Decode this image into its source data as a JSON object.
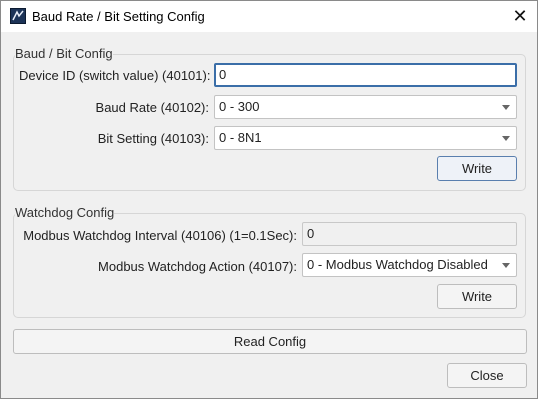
{
  "window": {
    "title": "Baud Rate / Bit Setting Config",
    "close_glyph": "✕"
  },
  "baud_bit_config": {
    "group_title": "Baud / Bit Config",
    "device_id_label": "Device ID (switch value) (40101):",
    "device_id_value": "0",
    "baud_rate_label": "Baud Rate (40102):",
    "baud_rate_value": "0 - 300",
    "bit_setting_label": "Bit Setting (40103):",
    "bit_setting_value": "0 - 8N1",
    "write_label": "Write"
  },
  "watchdog_config": {
    "group_title": "Watchdog Config",
    "interval_label": "Modbus Watchdog Interval (40106) (1=0.1Sec):",
    "interval_value": "0",
    "action_label": "Modbus Watchdog Action (40107):",
    "action_value": "0 - Modbus Watchdog Disabled",
    "write_label": "Write"
  },
  "footer": {
    "read_config_label": "Read Config",
    "close_label": "Close"
  },
  "icons": {
    "app": "app-icon",
    "close": "close-icon",
    "dropdown": "chevron-down-icon"
  },
  "colors": {
    "focus_border": "#3b6ea8",
    "default_button_border": "#5a7fae",
    "window_bg": "#f0f0f0"
  }
}
